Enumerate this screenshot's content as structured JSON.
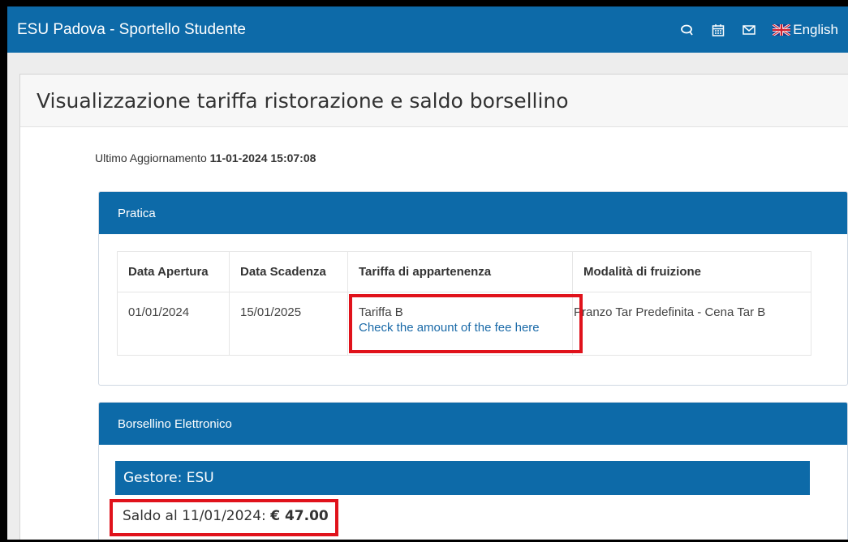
{
  "navbar": {
    "brand": "ESU Padova - Sportello Studente",
    "language": "English",
    "icons": [
      "chat-icon",
      "calendar-icon",
      "mail-icon",
      "uk-flag-icon"
    ]
  },
  "page": {
    "title": "Visualizzazione tariffa ristorazione e saldo borsellino",
    "updated_label": "Ultimo Aggiornamento",
    "updated_value": "11-01-2024 15:07:08"
  },
  "pratica": {
    "heading": "Pratica",
    "columns": [
      "Data Apertura",
      "Data Scadenza",
      "Tariffa di appartenenza",
      "Modalità di fruizione"
    ],
    "row": {
      "data_apertura": "01/01/2024",
      "data_scadenza": "15/01/2025",
      "tariffa": "Tariffa B",
      "tariffa_link": "Check the amount of the fee here",
      "modalita": "Pranzo Tar Predefinita - Cena Tar B"
    }
  },
  "borsellino": {
    "heading": "Borsellino Elettronico",
    "gestore": "Gestore: ESU",
    "saldo_label": "Saldo al 11/01/2024:",
    "saldo_value": "€ 47.00"
  },
  "colors": {
    "primary": "#0d6aa8",
    "highlight": "#e0121b"
  }
}
